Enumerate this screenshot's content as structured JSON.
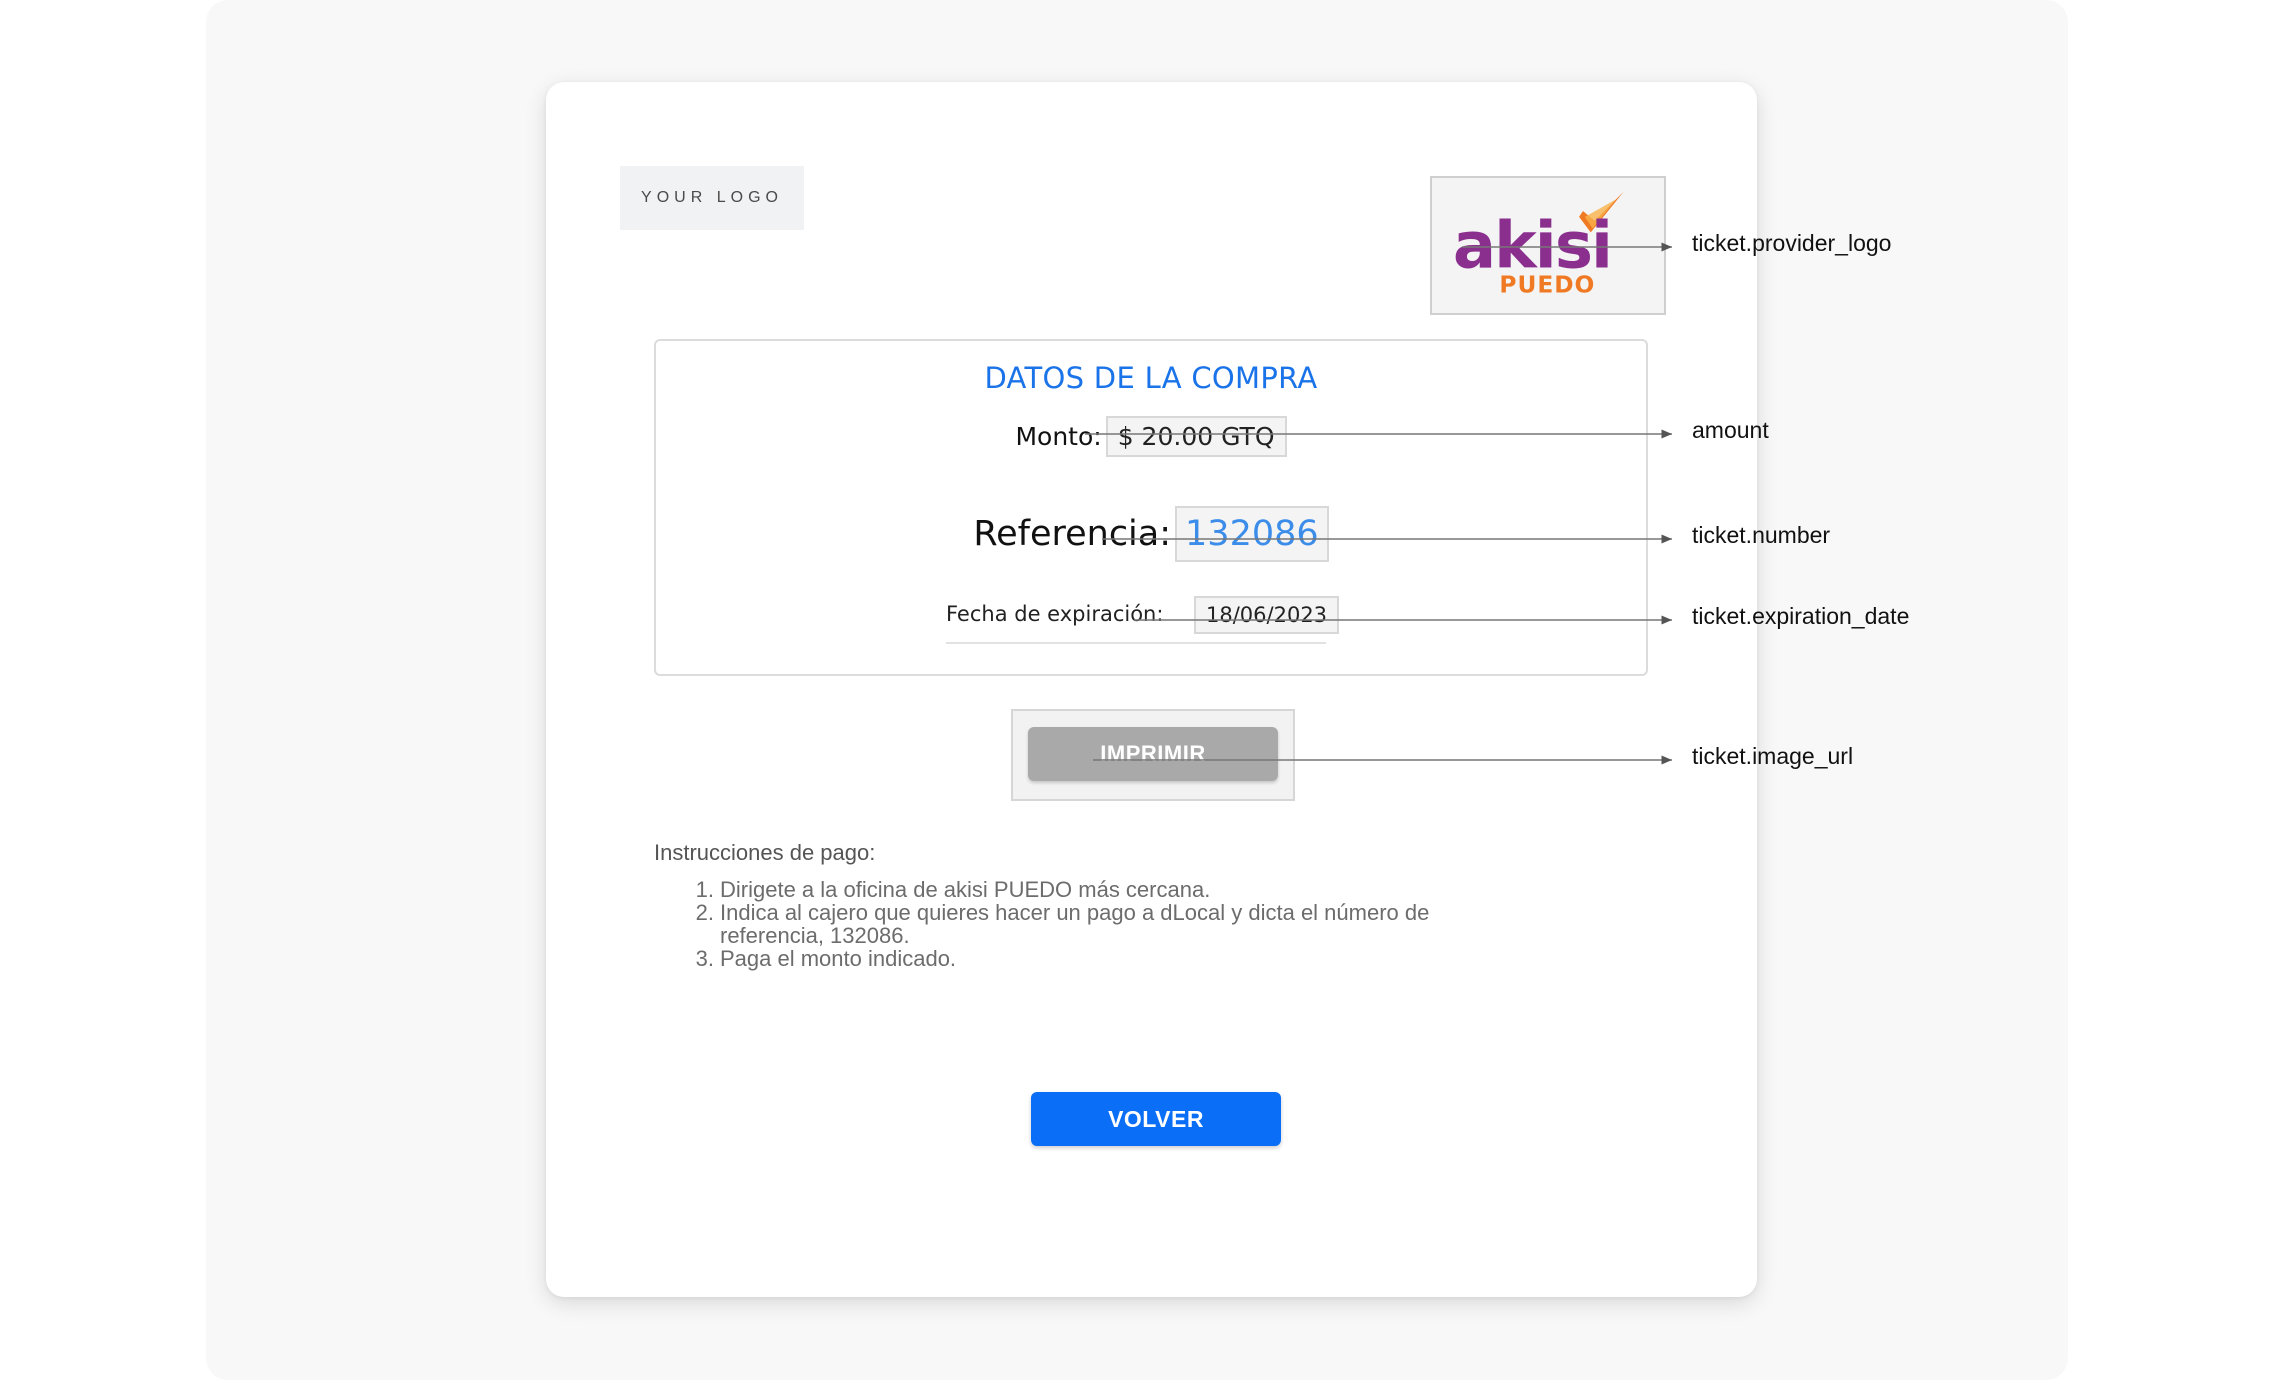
{
  "header": {
    "your_logo_text": "YOUR LOGO"
  },
  "provider_logo": {
    "name_top": "akisi",
    "name_bottom": "PUEDO",
    "colors": {
      "purple": "#8b2f8f",
      "orange": "#f07a24"
    }
  },
  "purchase": {
    "title": "DATOS DE LA COMPRA",
    "amount_label": "Monto:",
    "amount_value": "$ 20.00 GTQ",
    "reference_label": "Referencia:",
    "reference_value": "132086",
    "expiration_label": "Fecha de expiración:",
    "expiration_value": "18/06/2023"
  },
  "print_button": {
    "label": "IMPRIMIR"
  },
  "instructions": {
    "title": "Instrucciones de pago:",
    "items": [
      {
        "num": "1.",
        "text": "Dirigete a la oficina de akisi PUEDO más cercana."
      },
      {
        "num": "2.",
        "text": "Indica al cajero que quieres hacer un pago a dLocal y dicta el número de referencia, 132086."
      },
      {
        "num": "3.",
        "text": "Paga el monto indicado."
      }
    ]
  },
  "back_button": {
    "label": "VOLVER"
  },
  "annotations": [
    {
      "id": "provider_logo",
      "label": "ticket.provider_logo"
    },
    {
      "id": "amount",
      "label": "amount"
    },
    {
      "id": "number",
      "label": "ticket.number"
    },
    {
      "id": "expiration_date",
      "label": "ticket.expiration_date"
    },
    {
      "id": "image_url",
      "label": "ticket.image_url"
    }
  ],
  "colors": {
    "accent": "#1a73e8",
    "reference": "#3c8dea",
    "primary_button": "#0b6ef7",
    "disabled_button": "#a9a9a9"
  }
}
